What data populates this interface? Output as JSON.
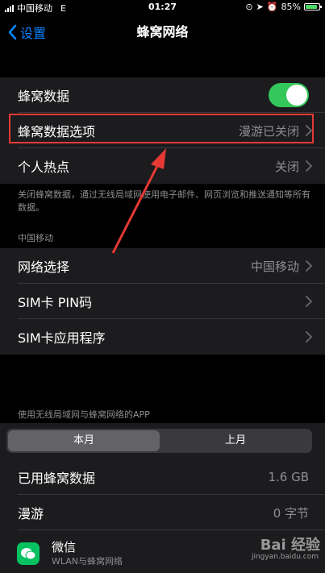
{
  "status_bar": {
    "carrier": "中国移动",
    "network": "E",
    "time": "01:27",
    "battery": "85%",
    "battery_level": 0.85
  },
  "nav": {
    "back_label": "设置",
    "title": "蜂窝网络"
  },
  "rows": {
    "cellular_data": "蜂窝数据",
    "cellular_options": "蜂窝数据选项",
    "cellular_options_value": "漫游已关闭",
    "hotspot": "个人热点",
    "hotspot_value": "关闭"
  },
  "note": "关闭蜂窝数据，通过无线局域网使用电子邮件、网页浏览和推送通知等所有数据。",
  "carrier_section": {
    "header": "中国移动",
    "network_select": "网络选择",
    "network_select_value": "中国移动",
    "sim_pin": "SIM卡 PIN码",
    "sim_apps": "SIM卡应用程序"
  },
  "apps_section": {
    "header": "使用无线局域网与蜂窝网络的APP",
    "tab_this_month": "本月",
    "tab_last_month": "上月",
    "used_data": "已用蜂窝数据",
    "used_data_value": "1.6 GB",
    "roaming": "漫游",
    "roaming_value": "0 字节",
    "app_name": "微信",
    "app_sub": "WLAN与蜂窝网络"
  },
  "watermark": {
    "logo": "Bai 经验",
    "url": "jingyan.baidu.com"
  },
  "colors": {
    "accent": "#0a84ff",
    "toggle_on": "#34c759",
    "highlight": "#e53935"
  }
}
